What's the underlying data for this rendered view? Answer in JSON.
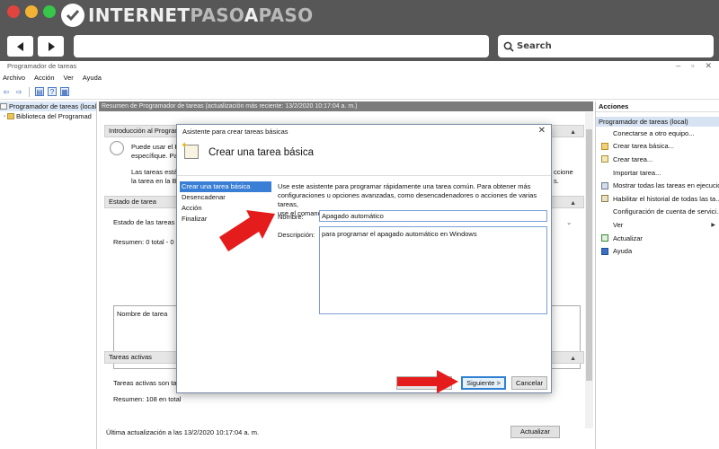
{
  "browser": {
    "logo_text_a": "INTERNET",
    "logo_text_b": "PASO",
    "logo_text_c": "A",
    "logo_text_d": "PASO",
    "search_label": "Search",
    "colors": {
      "close": "#e0443e",
      "minimize": "#f2b233",
      "maximize": "#35c64a"
    }
  },
  "app": {
    "window_title": "Programador de tareas",
    "menu": [
      "Archivo",
      "Acción",
      "Ver",
      "Ayuda"
    ],
    "tree": [
      {
        "label": "Programador de tareas (local"
      },
      {
        "label": "Biblioteca del Programad"
      }
    ],
    "center": {
      "header": "Resumen de Programador de tareas (actualización más reciente: 13/2/2020 10:17:04 a. m.)",
      "intro_title": "Introducción al Programa",
      "intro_line1": "Puede usar el P",
      "intro_line2": "específique. Par",
      "intro_line3": "Las tareas están",
      "intro_line4": "la tarea en la Bi",
      "intro_right1": "ccione",
      "intro_right2": "s.",
      "status_title": "Estado de tarea",
      "status_line": "Estado de las tareas qu",
      "summary_line": "Resumen: 0 total - 0 en",
      "task_name_header": "Nombre de tarea",
      "active_title": "Tareas activas",
      "active_line": "Tareas activas son ta",
      "active_summary": "Resumen: 108 en total",
      "last_update": "Última actualización a las 13/2/2020 10:17:04 a. m.",
      "refresh_button": "Actualizar"
    },
    "actions": {
      "title": "Acciones",
      "subtitle": "Programador de tareas (local)",
      "items": [
        {
          "label": "Conectarse a otro equipo...",
          "icon": "none"
        },
        {
          "label": "Crear tarea básica...",
          "icon": "wizard-icon"
        },
        {
          "label": "Crear tarea...",
          "icon": "task-icon"
        },
        {
          "label": "Importar tarea...",
          "icon": "none"
        },
        {
          "label": "Mostrar todas las tareas en ejecución",
          "icon": "list-icon"
        },
        {
          "label": "Habilitar el historial de todas las ta...",
          "icon": "history-icon"
        },
        {
          "label": "Configuración de cuenta de servici...",
          "icon": "none"
        },
        {
          "label": "Ver",
          "icon": "none",
          "submenu": true
        },
        {
          "label": "Actualizar",
          "icon": "refresh-icon"
        },
        {
          "label": "Ayuda",
          "icon": "help-icon"
        }
      ]
    }
  },
  "wizard": {
    "title": "Asistente para crear tareas básicas",
    "header": "Crear una tarea básica",
    "steps": [
      "Crear una tarea básica",
      "Desencadenar",
      "Acción",
      "Finalizar"
    ],
    "active_step": 0,
    "description": "Use este asistente para programar rápidamente una tarea común. Para obtener más\nconfiguraciones u opciones avanzadas, como desencadenadores o acciones de varias tareas,\nuse el comando Crear tarea del panel Acciones.",
    "name_label": "Nombre:",
    "name_value": "Apagado automático",
    "desc_label": "Descripción:",
    "desc_value": "para programar el apagado automático en Windows",
    "next_button": "Siguiente >",
    "cancel_button": "Cancelar"
  }
}
